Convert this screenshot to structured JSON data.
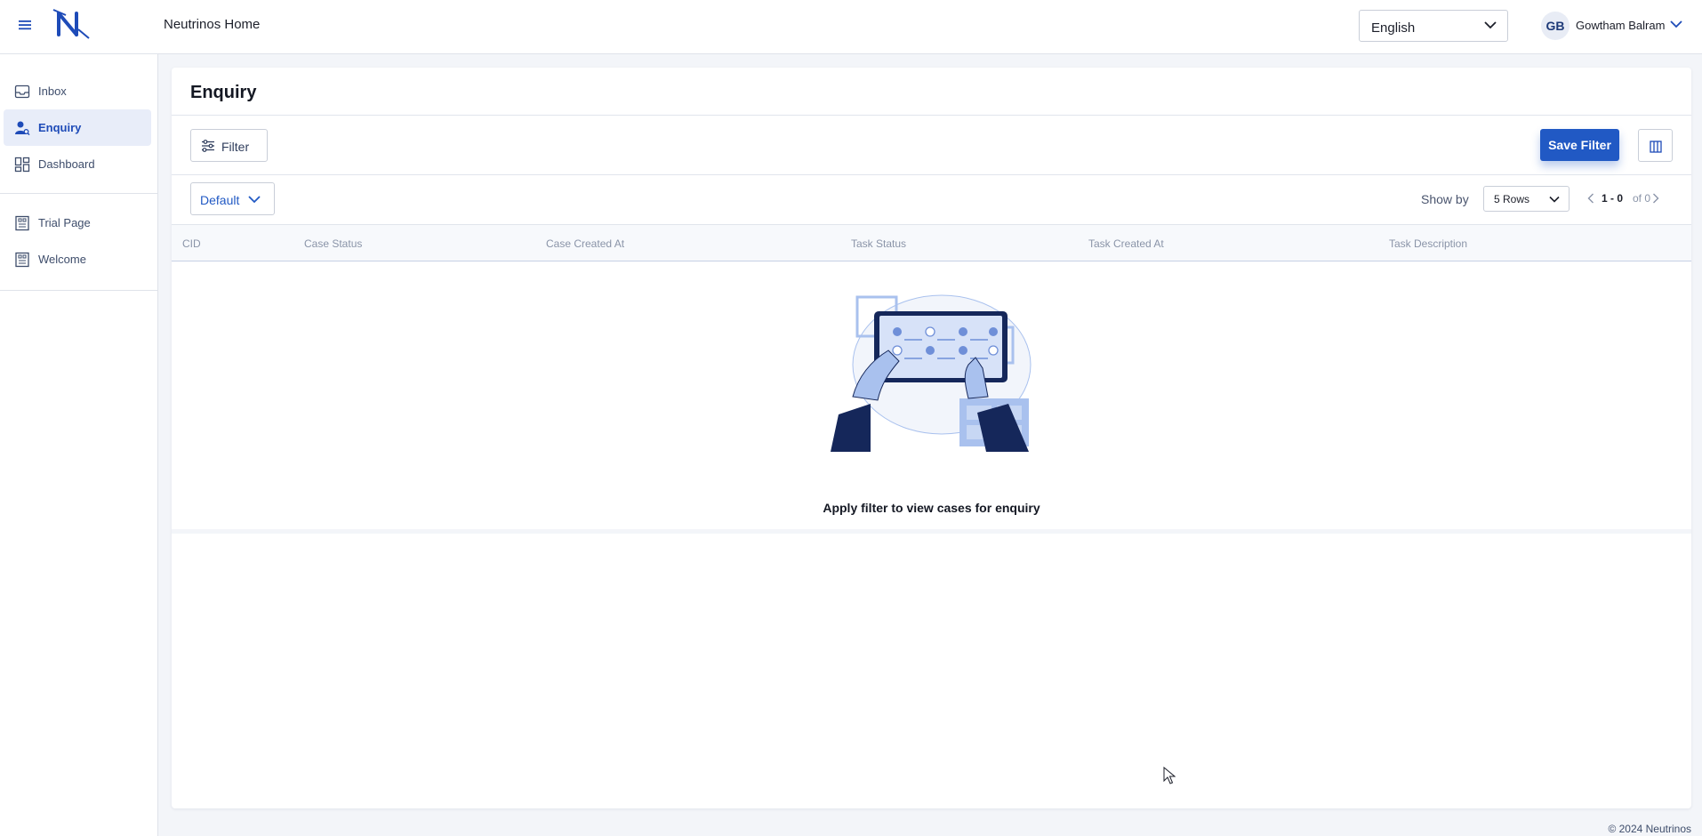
{
  "header": {
    "app_title": "Neutrinos Home",
    "language": "English",
    "user_initials": "GB",
    "user_name": "Gowtham Balram",
    "logo_icon": "neutrinos-logo-icon",
    "menu_icon": "hamburger-menu-icon"
  },
  "sidebar": {
    "items": [
      {
        "label": "Inbox",
        "icon": "inbox-icon"
      },
      {
        "label": "Enquiry",
        "icon": "user-search-icon",
        "active": true
      },
      {
        "label": "Dashboard",
        "icon": "dashboard-grid-icon"
      },
      {
        "label": "Trial Page",
        "icon": "page-icon"
      },
      {
        "label": "Welcome",
        "icon": "page-icon"
      }
    ]
  },
  "main": {
    "title": "Enquiry",
    "filter_label": "Filter",
    "save_filter_label": "Save Filter",
    "view_label": "Default",
    "show_by_label": "Show by",
    "rows_option": "5 Rows",
    "pager_range": "1 - 0",
    "pager_of": "of 0",
    "columns": [
      "CID",
      "Case Status",
      "Case Created At",
      "Task Status",
      "Task Created At",
      "Task Description"
    ],
    "empty_message": "Apply filter to view cases for enquiry"
  },
  "footer": {
    "copyright": "© 2024 Neutrinos"
  },
  "colors": {
    "accent": "#2159c4",
    "navy": "#1e3a78",
    "illustration_light": "#a9c1ee"
  }
}
